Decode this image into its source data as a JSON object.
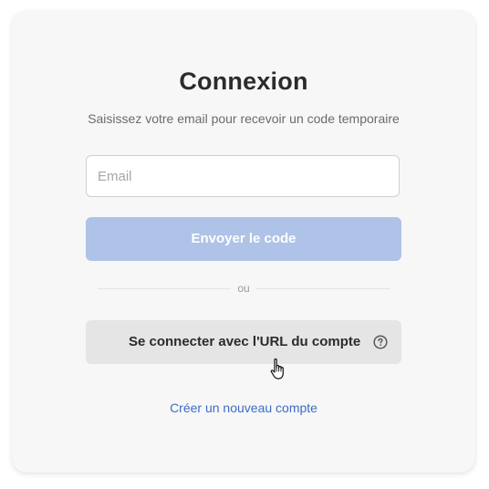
{
  "login": {
    "title": "Connexion",
    "subtitle": "Saisissez votre email pour recevoir un code temporaire",
    "email_placeholder": "Email",
    "email_value": "",
    "send_code_label": "Envoyer le code",
    "divider_text": "ou",
    "account_url_label": "Se connecter avec l'URL du compte",
    "create_account_label": "Créer un nouveau compte"
  },
  "icons": {
    "help": "help-circle-icon",
    "cursor": "hand-pointer-cursor-icon"
  },
  "colors": {
    "card_background": "#f7f7f7",
    "send_button_disabled": "#aec3e7",
    "secondary_button": "#e5e5e5",
    "link": "#3d6cc6",
    "title_text": "#2b2b2b"
  }
}
